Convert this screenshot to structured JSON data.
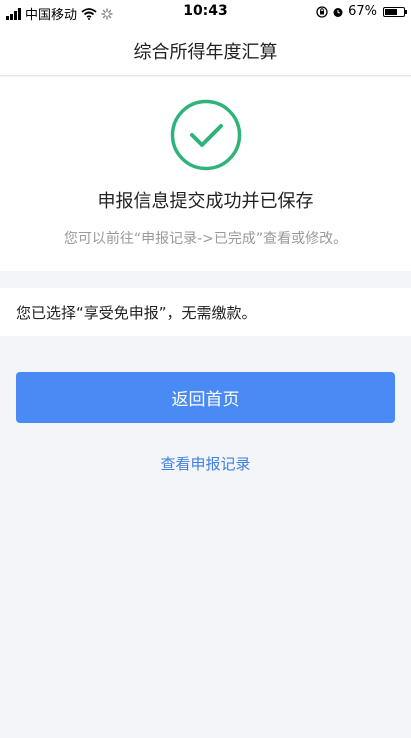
{
  "status_bar": {
    "carrier": "中国移动",
    "time": "10:43",
    "battery_percent_text": "67%",
    "battery_level": 0.67
  },
  "nav": {
    "title": "综合所得年度汇算"
  },
  "result": {
    "title": "申报信息提交成功并已保存",
    "hint": "您可以前往“申报记录->已完成”查看或修改。",
    "icon": "check-circle-icon",
    "icon_color": "#2fb37a"
  },
  "choice": {
    "text": "您已选择“享受免申报”，无需缴款。"
  },
  "actions": {
    "home_label": "返回首页",
    "records_label": "查看申报记录",
    "accent_color": "#4a8af4"
  }
}
